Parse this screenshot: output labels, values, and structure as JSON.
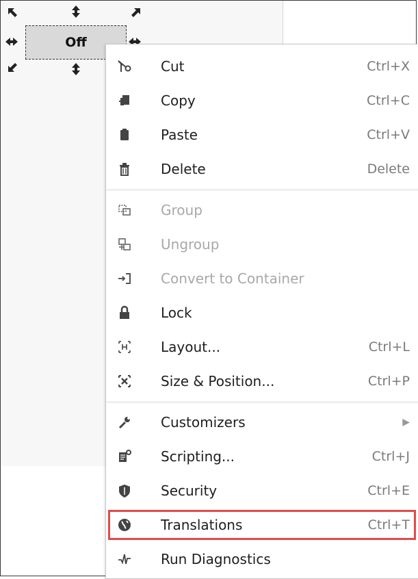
{
  "component": {
    "label": "Off"
  },
  "menu": {
    "items": [
      {
        "label": "Cut",
        "shortcut": "Ctrl+X",
        "icon": "scissors-icon"
      },
      {
        "label": "Copy",
        "shortcut": "Ctrl+C",
        "icon": "copy-icon"
      },
      {
        "label": "Paste",
        "shortcut": "Ctrl+V",
        "icon": "paste-icon"
      },
      {
        "label": "Delete",
        "shortcut": "Delete",
        "icon": "trash-icon"
      },
      {
        "label": "Group",
        "shortcut": "",
        "icon": "group-icon",
        "disabled": true
      },
      {
        "label": "Ungroup",
        "shortcut": "",
        "icon": "ungroup-icon",
        "disabled": true
      },
      {
        "label": "Convert to Container",
        "shortcut": "",
        "icon": "convert-container-icon",
        "disabled": true
      },
      {
        "label": "Lock",
        "shortcut": "",
        "icon": "lock-icon"
      },
      {
        "label": "Layout...",
        "shortcut": "Ctrl+L",
        "icon": "layout-icon"
      },
      {
        "label": "Size & Position...",
        "shortcut": "Ctrl+P",
        "icon": "size-position-icon"
      },
      {
        "label": "Customizers",
        "shortcut": "",
        "icon": "wrench-icon",
        "submenu": true
      },
      {
        "label": "Scripting...",
        "shortcut": "Ctrl+J",
        "icon": "scripting-icon"
      },
      {
        "label": "Security",
        "shortcut": "Ctrl+E",
        "icon": "shield-icon"
      },
      {
        "label": "Translations",
        "shortcut": "Ctrl+T",
        "icon": "globe-icon",
        "highlighted": true
      },
      {
        "label": "Run Diagnostics",
        "shortcut": "",
        "icon": "diagnostics-icon"
      }
    ],
    "highlight_color": "#e24a4a"
  }
}
